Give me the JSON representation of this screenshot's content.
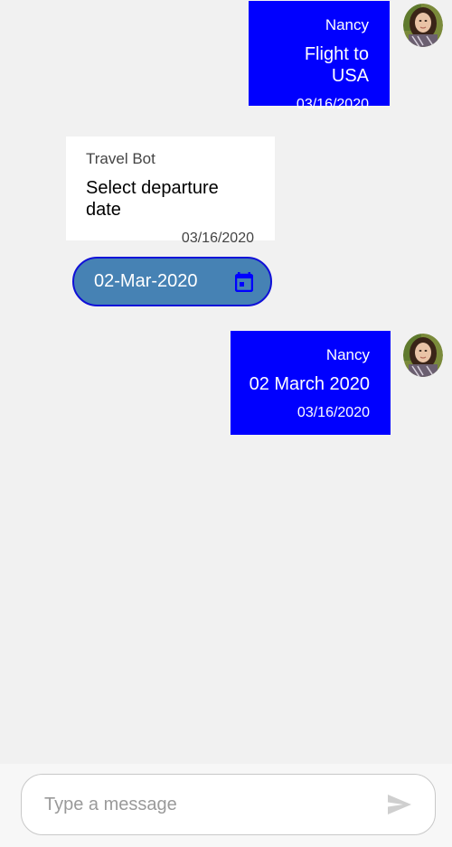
{
  "messages": [
    {
      "direction": "outgoing",
      "author": "Nancy",
      "text": "Flight to USA",
      "time": "03/16/2020",
      "avatar": "user-avatar-photo"
    },
    {
      "direction": "incoming",
      "author": "Travel Bot",
      "text": "Select departure date",
      "time": "03/16/2020"
    },
    {
      "direction": "outgoing",
      "author": "Nancy",
      "text": "02 March 2020",
      "time": "03/16/2020",
      "avatar": "user-avatar-photo"
    }
  ],
  "date_picker": {
    "value": "02-Mar-2020",
    "icon": "calendar-icon"
  },
  "composer": {
    "placeholder": "Type a message",
    "value": "",
    "send_icon": "send-icon"
  },
  "colors": {
    "outgoing_bubble": "#0000ff",
    "incoming_bubble": "#ffffff",
    "date_pill": "#4682b4",
    "date_pill_border": "#1010d8",
    "calendar_icon": "#0000ff",
    "background": "#f1f1f1"
  }
}
